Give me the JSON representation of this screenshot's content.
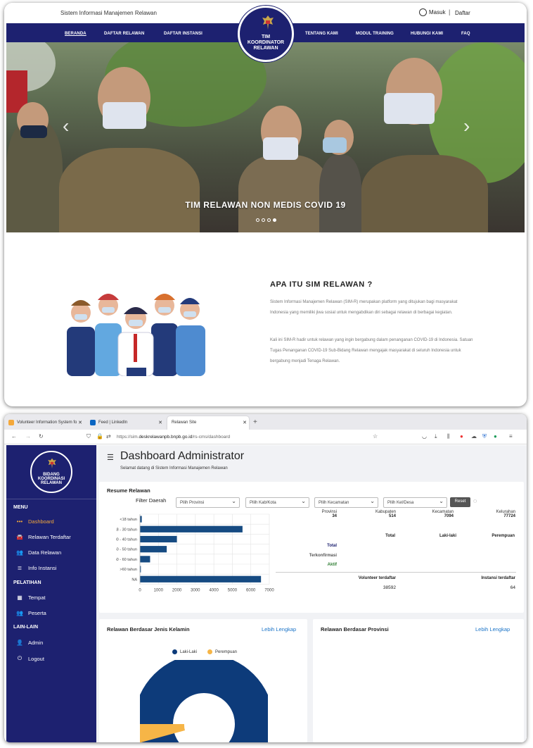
{
  "site": {
    "title": "Sistem Informasi Manajemen Relawan",
    "login": "Masuk",
    "separator": "|",
    "register": "Daftar",
    "logo_lines": [
      "TIM",
      "KOORDINATOR",
      "RELAWAN"
    ],
    "nav_left": [
      "BERANDA",
      "DAFTAR RELAWAN",
      "DAFTAR INSTANSI"
    ],
    "nav_right": [
      "TENTANG KAMI",
      "MODUL TRAINING",
      "HUBUNGI KAMI",
      "FAQ"
    ],
    "hero_caption": "TIM RELAWAN NON MEDIS COVID 19",
    "slides": 4,
    "active_slide": 4,
    "about_title": "APA ITU SIM RELAWAN ?",
    "about_p1": "Sistem Informasi Manajemen Relawan (SIM-R) merupakan platform yang ditujukan bagi masyarakat Indonesia yang memiliki jiwa sosial untuk mengabdikan diri sebagai relawan di berbagai kegiatan.",
    "about_p2": "Kali ini SIM-R hadir untuk relawan yang ingin bergabung dalam penanganan COVID-19 di Indonesia. Satuan Tugas Penanganan COVID-19 Sub-Bidang Relawan mengajak masyarakat di seluruh Indonesia untuk bergabung menjadi Tenaga Relawan."
  },
  "browser": {
    "tabs": [
      "Volunteer Information System fo",
      "Feed | LinkedIn",
      "Relawan Site"
    ],
    "new_tab": "+",
    "url_prefix": "https://sim.",
    "url_host": "deskrelawanpb.bnpb.go.id",
    "url_path": "/rs-cms/dashboard"
  },
  "sidebar": {
    "logo_lines": [
      "BIDANG",
      "KOORDINASI",
      "RELAWAN"
    ],
    "section_menu": "MENU",
    "section_pelatihan": "PELATIHAN",
    "section_lain": "LAIN-LAIN",
    "items": [
      {
        "label": "Dashboard",
        "icon": "dashboard-icon",
        "glyph": "•••"
      },
      {
        "label": "Relawan Terdaftar",
        "icon": "car-icon",
        "glyph": "🚘"
      },
      {
        "label": "Data Relawan",
        "icon": "users-icon",
        "glyph": "👥"
      },
      {
        "label": "Info Instansi",
        "icon": "database-icon",
        "glyph": "≣"
      },
      {
        "label": "Tempat",
        "icon": "building-icon",
        "glyph": "▦"
      },
      {
        "label": "Peserta",
        "icon": "users-icon",
        "glyph": "👥"
      },
      {
        "label": "Admin",
        "icon": "user-gear-icon",
        "glyph": "👤"
      },
      {
        "label": "Logout",
        "icon": "power-icon",
        "glyph": "⏻"
      }
    ]
  },
  "dashboard": {
    "title": "Dashboard Administrator",
    "subtitle": "Selamat datang di Sistem Informasi Manajemen Relawan",
    "resume_title": "Resume Relawan",
    "filter_label": "Filter Daerah",
    "filters": [
      "Pilih Provinsi",
      "Pilih Kab/Kota",
      "Pilih Kecamatan",
      "Pilih Kel/Desa"
    ],
    "reset": "Reset",
    "regions": [
      {
        "label": "Provinsi",
        "value": "34"
      },
      {
        "label": "Kabupaten",
        "value": "514"
      },
      {
        "label": "Kecamatan",
        "value": "7094"
      },
      {
        "label": "Kelurahan",
        "value": "77724"
      }
    ],
    "table_headers": [
      "Total",
      "Laki-laki",
      "Perempuan"
    ],
    "row_labels": [
      "Total",
      "Terkonfirmasi",
      "Aktif"
    ],
    "row_colors": [
      "#1d2170",
      "#555555",
      "#2e7d32"
    ],
    "volunteer_label": "Volunteer terdaftar",
    "volunteer_value": "38592",
    "instansi_label": "Instansi terdaftar",
    "instansi_value": "64",
    "gender_title": "Relawan Berdasar Jenis Kelamin",
    "province_title": "Relawan Berdasar Provinsi",
    "more_link": "Lebih Lengkap",
    "accent": "#1d2170",
    "bar_color": "#164b82"
  },
  "chart_data": [
    {
      "type": "bar",
      "orientation": "horizontal",
      "categories": [
        "<18 tahun",
        "18 - 30 tahun",
        "30 - 40 tahun",
        "40 - 50 tahun",
        "50 - 60 tahun",
        ">60 tahun",
        "NA"
      ],
      "values": [
        100,
        5550,
        2000,
        1450,
        550,
        50,
        6550
      ],
      "xlim": [
        0,
        7000
      ],
      "xticks": [
        0,
        1000,
        2000,
        3000,
        4000,
        5000,
        6000,
        7000
      ],
      "grid": true
    },
    {
      "type": "pie",
      "series": [
        {
          "name": "Laki-Laki",
          "color": "#0d3b7a"
        },
        {
          "name": "Perempuan",
          "color": "#f6b547"
        }
      ]
    }
  ]
}
